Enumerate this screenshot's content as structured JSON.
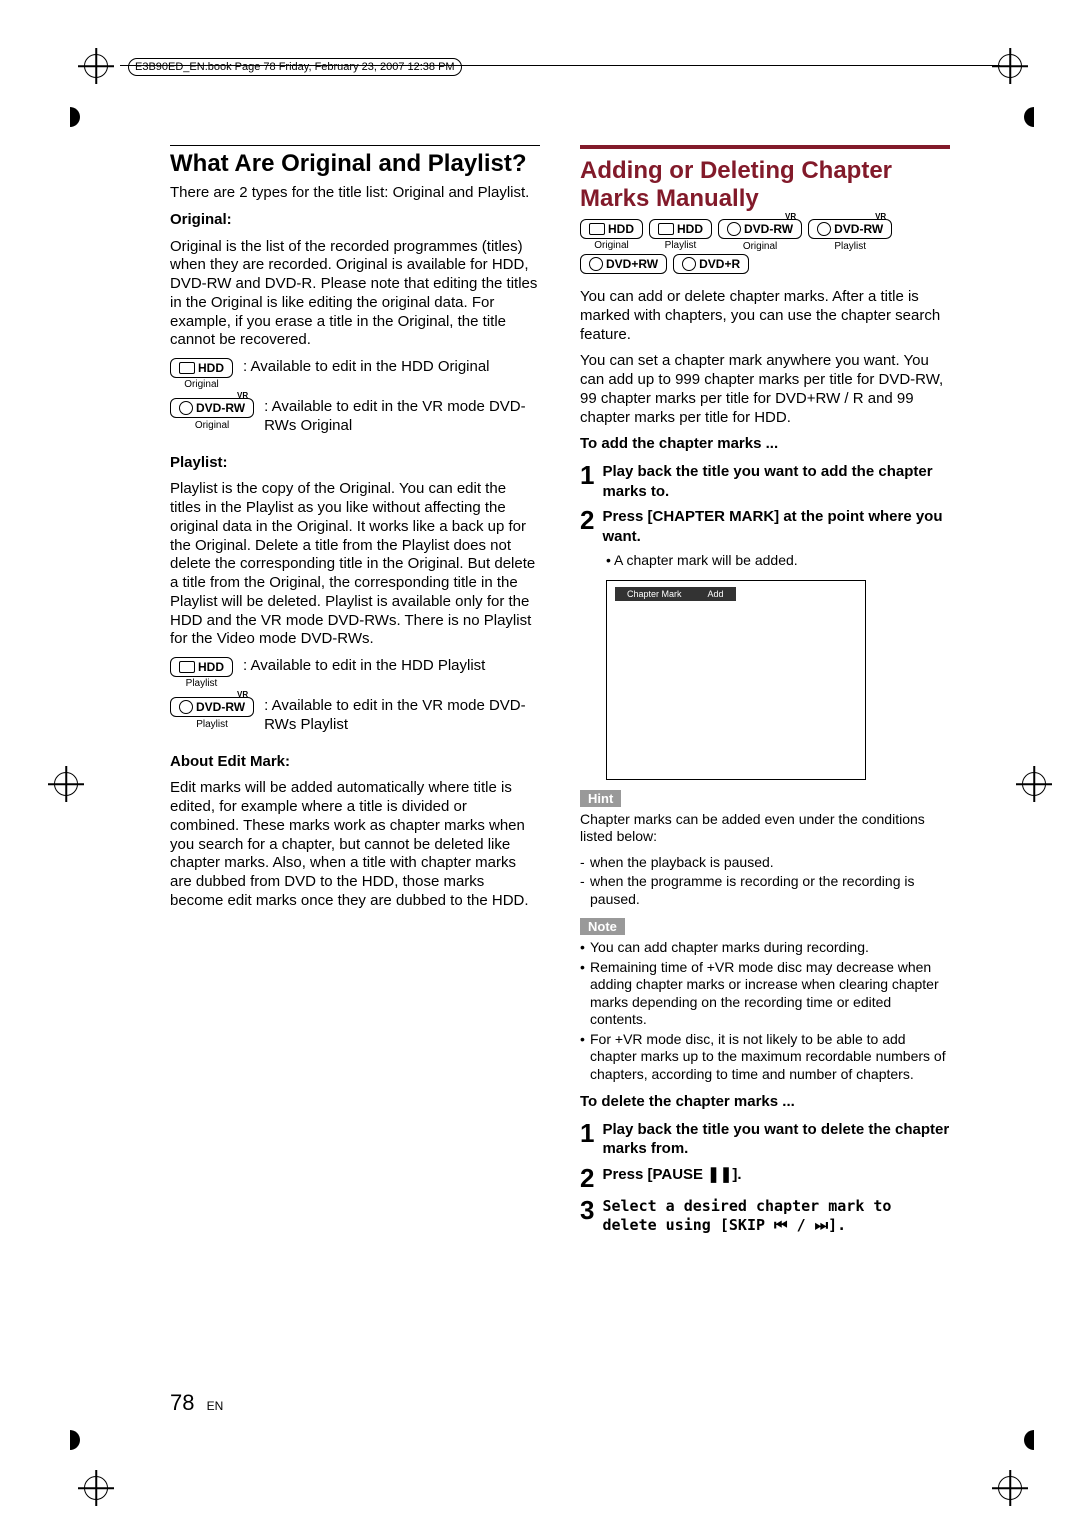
{
  "header": {
    "filepath_text": "E3B90ED_EN.book  Page 78  Friday, February 23, 2007  12:38 PM"
  },
  "left": {
    "title": "What Are Original and Playlist?",
    "intro": "There are 2 types for the title list: Original and Playlist.",
    "original_heading": "Original:",
    "original_body": "Original is the list of the recorded programmes (titles) when they are recorded. Original is available for HDD, DVD-RW and DVD-R. Please note that editing the titles in the Original is like editing the original data. For example, if you erase a title in the Original, the title cannot be recovered.",
    "badge_hdd": "HDD",
    "badge_dvdrw": "DVD-RW",
    "badge_vr": "VR",
    "cap_original": "Original",
    "cap_playlist": "Playlist",
    "orig_hdd_text": ": Available to edit in the HDD Original",
    "orig_dvdrw_text": ": Available to edit in the VR mode DVD-RWs Original",
    "playlist_heading": "Playlist:",
    "playlist_body": "Playlist is the copy of the Original. You can edit the titles in the Playlist as you like without affecting the original data in the Original. It works like a back up for the Original. Delete a title from the Playlist does not delete the corresponding title in the Original. But delete a title from the Original, the corresponding title in the Playlist will be deleted. Playlist is available only for the HDD and the VR mode DVD-RWs. There is no Playlist for the Video mode DVD-RWs.",
    "pl_hdd_text": ": Available to edit in the HDD Playlist",
    "pl_dvdrw_text": ": Available to edit in the VR mode DVD-RWs Playlist",
    "editmark_heading": "About Edit Mark:",
    "editmark_body": "Edit marks will be added automatically where title is edited, for example where a title is divided or combined. These marks work as chapter marks when you search for a chapter, but cannot be deleted like chapter marks. Also, when a title with chapter marks are dubbed from DVD to the HDD, those marks become edit marks once they are dubbed to the HDD."
  },
  "right": {
    "title": "Adding or Deleting Chapter Marks Manually",
    "badge_dvd_plus_rw": "DVD+RW",
    "badge_dvd_plus_r": "DVD+R",
    "body1": "You can add or delete chapter marks. After a title is marked with chapters, you can use the chapter search feature.",
    "body2": "You can set a chapter mark anywhere you want. You can add up to 999 chapter marks per title for DVD-RW, 99 chapter marks per title for DVD+RW / R and 99 chapter marks per title for HDD.",
    "to_add": "To add the chapter marks ...",
    "step1a": "Play back the title you want to add the chapter marks to.",
    "step2a": "Press [CHAPTER MARK] at the point where you want.",
    "step2a_sub": "• A chapter mark will be added.",
    "preview_label1": "Chapter Mark",
    "preview_label2": "Add",
    "hint_label": "Hint",
    "hint_body": "Chapter marks can be added even under the conditions listed below:",
    "hint_item1": "when the playback is paused.",
    "hint_item2": "when the programme is recording or the recording is paused.",
    "note_label": "Note",
    "note_item1": "You can add chapter marks during recording.",
    "note_item2": "Remaining time of +VR mode disc may decrease when adding chapter marks or increase when clearing chapter marks depending on the recording time or edited contents.",
    "note_item3": "For +VR mode disc, it is not likely to be able to add chapter marks up to the maximum recordable numbers of chapters, according to time and number of chapters.",
    "to_delete": "To delete the chapter marks ...",
    "step1b": "Play back the title you want to delete the chapter marks from.",
    "step2b": "Press [PAUSE ❚❚].",
    "step3b": "Select a desired chapter mark to delete using [SKIP ⏮ / ⏭].",
    "num1": "1",
    "num2": "2",
    "num3": "3"
  },
  "pagenum": {
    "num": "78",
    "lang": "EN"
  }
}
